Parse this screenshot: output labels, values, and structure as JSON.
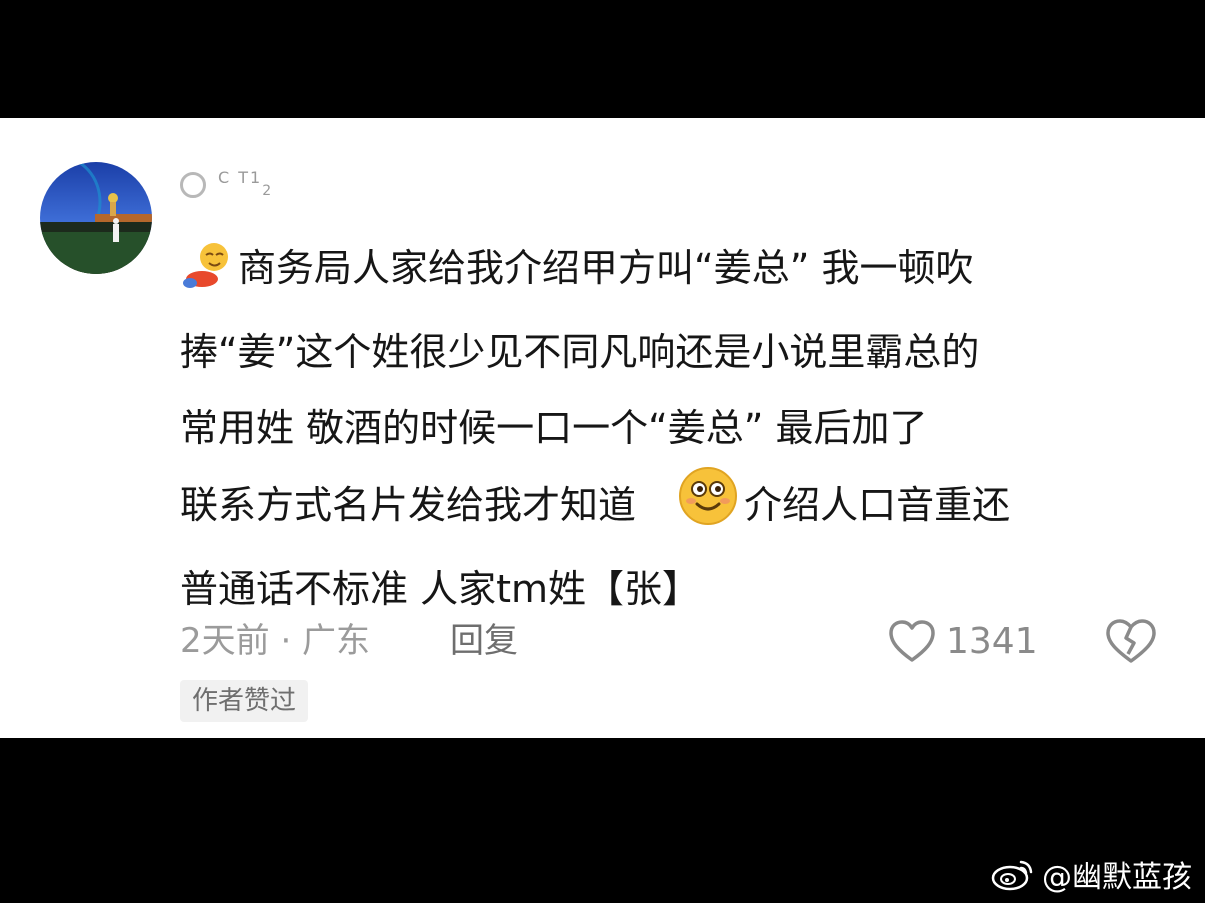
{
  "comment": {
    "username": {
      "main": "C T1",
      "sub": "2"
    },
    "lines": [
      "商务局人家给我介绍甲方叫“姜总”  我一顿吹",
      "捧“姜”这个姓很少见不同凡响还是小说里霸总的",
      "常用姓  敬酒的时候一口一个“姜总”  最后加了",
      "联系方式名片发给我才知道",
      "介绍人口音重还",
      "普通话不标准  人家tm姓【张】"
    ],
    "meta": "2天前 · 广东",
    "reply_label": "回复",
    "like_count": "1341",
    "author_badge": "作者赞过"
  },
  "watermark": {
    "text": "@幽默蓝孩",
    "icon": "weibo-icon"
  },
  "colors": {
    "frame": "#000000",
    "card": "#ffffff",
    "text": "#161616",
    "meta": "#9b9b9b",
    "badge_bg": "#f1f1f1"
  }
}
